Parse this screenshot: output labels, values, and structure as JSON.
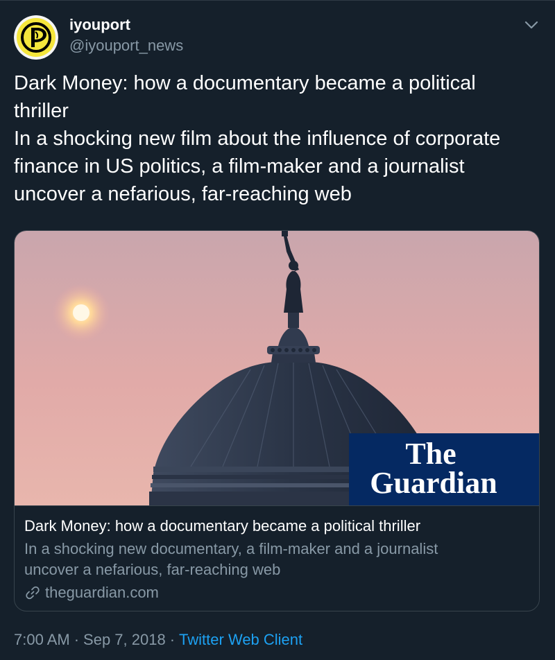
{
  "tweet": {
    "author": {
      "display_name": "iyouport",
      "handle": "@iyouport_news",
      "avatar_icon": "pirate-sail-logo-icon",
      "avatar_colors": {
        "background": "#f5e63c",
        "ring": "#000000",
        "sail": "#000000"
      }
    },
    "caret_icon": "chevron-down-icon",
    "text_lines": [
      "Dark Money: how a documentary became a political",
      "thriller",
      "In a shocking new film about the influence of corporate",
      "finance in US politics, a film-maker and a journalist",
      "uncover a nefarious, far-reaching web"
    ],
    "card": {
      "image": {
        "description_icon": "capitol-dome-statue-sunset-photo",
        "logo_line1": "The",
        "logo_line2": "Guardian",
        "logo_background": "#052962"
      },
      "title": "Dark Money: how a documentary became a political thriller",
      "description_lines": [
        "In a shocking new documentary, a film-maker and a journalist",
        "uncover a nefarious, far-reaching web"
      ],
      "domain_icon": "link-icon",
      "domain": "theguardian.com"
    },
    "meta": {
      "time": "7:00 AM",
      "separator": "·",
      "date": "Sep 7, 2018",
      "source": "Twitter Web Client"
    },
    "colors": {
      "background": "#15202b",
      "secondary_text": "#8899a6",
      "link": "#1da1f2",
      "border": "#38444d"
    }
  }
}
